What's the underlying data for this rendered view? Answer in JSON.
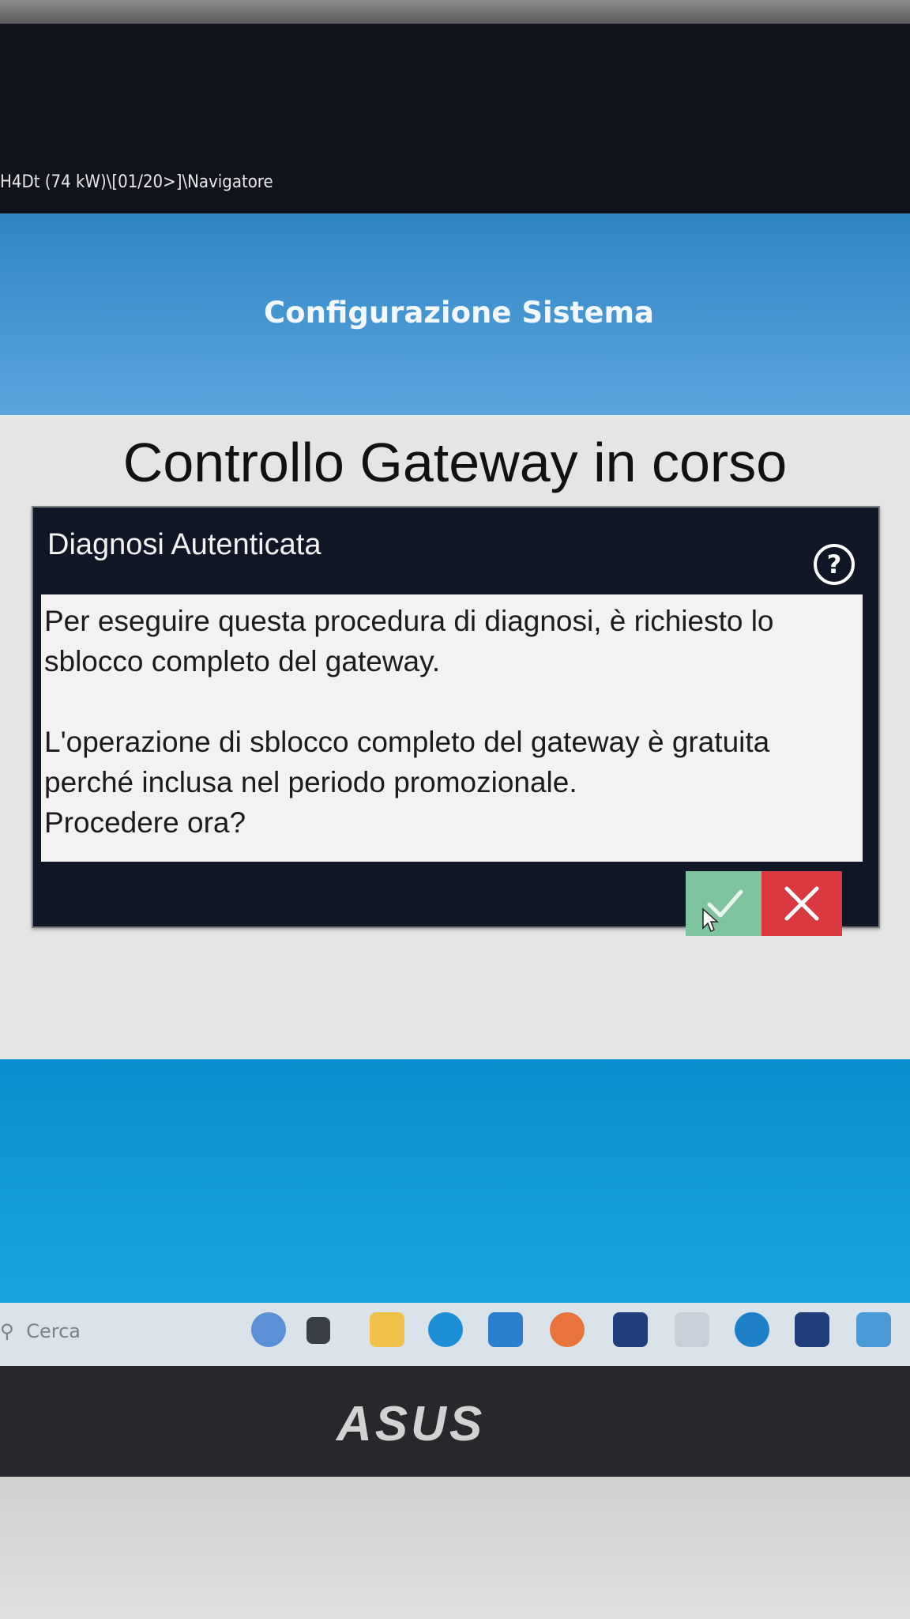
{
  "window": {
    "path": "H4Dt (74 kW)\\[01/20>]\\Navigatore"
  },
  "banner": {
    "title": "Configurazione Sistema"
  },
  "page": {
    "heading": "Controllo Gateway in corso"
  },
  "dialog": {
    "title": "Diagnosi Autenticata",
    "help_icon": "question-circle",
    "message": "Per eseguire questa procedura di diagnosi, è richiesto lo sblocco completo del gateway.\n\nL'operazione di sblocco completo del gateway è gratuita perché inclusa nel periodo promozionale.\nProcedere ora?",
    "confirm_icon": "check",
    "cancel_icon": "x",
    "colors": {
      "confirm": "#7fc39f",
      "cancel": "#d9393f",
      "header": "#111626"
    }
  },
  "taskbar": {
    "search_placeholder": "Cerca"
  },
  "device": {
    "brand": "ASUS"
  }
}
